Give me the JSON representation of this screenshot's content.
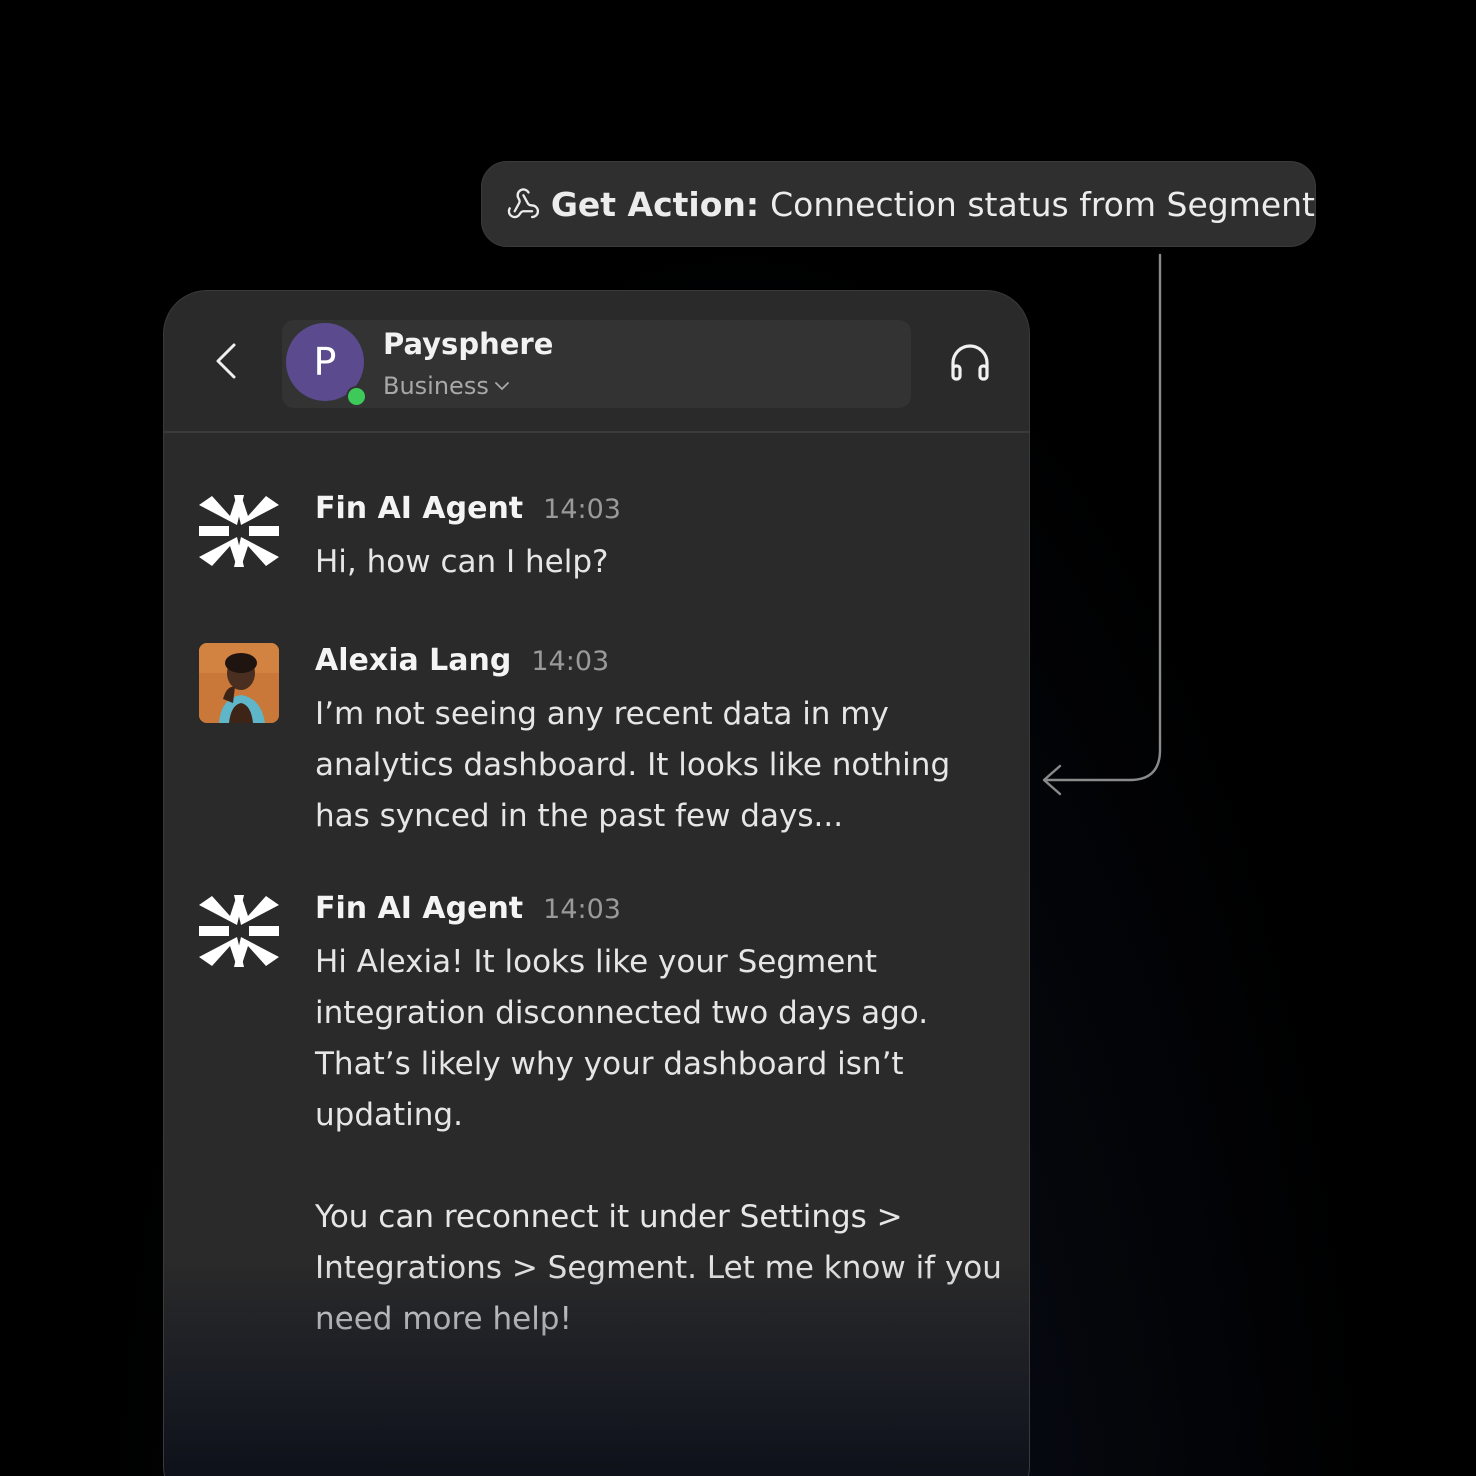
{
  "action": {
    "label": "Get Action:",
    "text": "Connection status from Segment",
    "icon": "webhook-icon"
  },
  "header": {
    "back_icon": "chevron-left-icon",
    "company": {
      "initial": "P",
      "name": "Paysphere",
      "plan": "Business",
      "status": "online",
      "status_color": "#3ec95b",
      "avatar_color": "#5b4a8e"
    },
    "support_icon": "headphones-icon"
  },
  "messages": [
    {
      "sender": "Fin AI Agent",
      "time": "14:03",
      "avatar": "fin-logo-icon",
      "text": "Hi, how can I help?"
    },
    {
      "sender": "Alexia Lang",
      "time": "14:03",
      "avatar": "user-photo",
      "text": "I’m not seeing any recent data in my\nanalytics dashboard. It looks like nothing\nhas synced in the past few days..."
    },
    {
      "sender": "Fin AI Agent",
      "time": "14:03",
      "avatar": "fin-logo-icon",
      "text": "Hi Alexia! It looks like your Segment\nintegration disconnected two days ago.\nThat’s likely why your dashboard isn’t\nupdating.\n\nYou can reconnect it under Settings >\nIntegrations > Segment. Let me know if you\nneed more help!"
    }
  ]
}
